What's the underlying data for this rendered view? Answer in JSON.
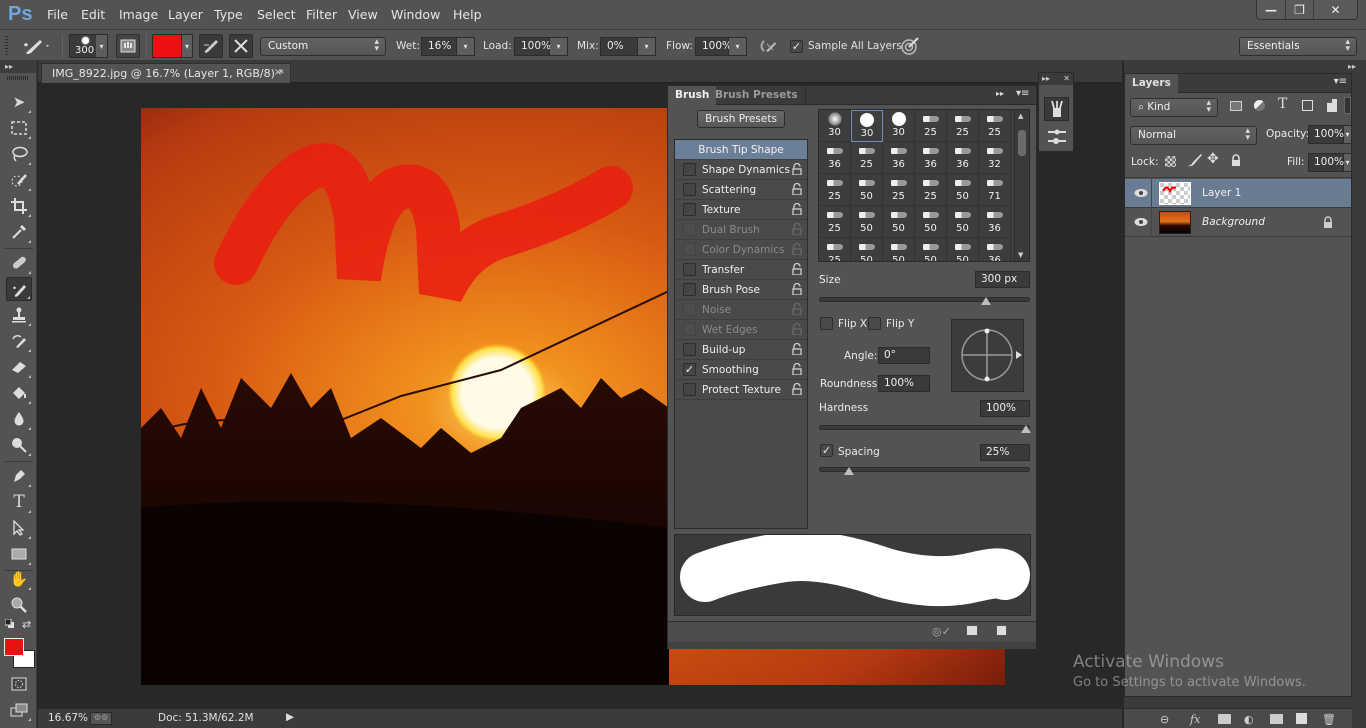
{
  "app": {
    "logo": "Ps"
  },
  "menu": [
    "File",
    "Edit",
    "Image",
    "Layer",
    "Type",
    "Select",
    "Filter",
    "View",
    "Window",
    "Help"
  ],
  "window_controls": {
    "minimize": "—",
    "restore": "❐",
    "close": "✕"
  },
  "options_bar": {
    "brush_size": "300",
    "foreground_color": "#ee1111",
    "preset_mix": "Custom",
    "wet_label": "Wet:",
    "wet_value": "16%",
    "load_label": "Load:",
    "load_value": "100%",
    "mix_label": "Mix:",
    "mix_value": "0%",
    "flow_label": "Flow:",
    "flow_value": "100%",
    "sample_all_layers_label": "Sample All Layers",
    "sample_all_layers_checked": true,
    "workspace": "Essentials"
  },
  "document": {
    "tab_title": "IMG_8922.jpg @ 16.7% (Layer 1, RGB/8) *",
    "close": "×"
  },
  "status_bar": {
    "zoom": "16.67%",
    "doc_info": "Doc: 51.3M/62.2M"
  },
  "brush_panel": {
    "tabs": [
      "Brush",
      "Brush Presets"
    ],
    "presets_button": "Brush Presets",
    "list": [
      {
        "label": "Brush Tip Shape",
        "selected": true
      },
      {
        "label": "Shape Dynamics",
        "checked": false,
        "enabled": true
      },
      {
        "label": "Scattering",
        "checked": false,
        "enabled": true
      },
      {
        "label": "Texture",
        "checked": false,
        "enabled": true
      },
      {
        "label": "Dual Brush",
        "checked": false,
        "enabled": false
      },
      {
        "label": "Color Dynamics",
        "checked": false,
        "enabled": false
      },
      {
        "label": "Transfer",
        "checked": false,
        "enabled": true
      },
      {
        "label": "Brush Pose",
        "checked": false,
        "enabled": true
      },
      {
        "label": "Noise",
        "checked": false,
        "enabled": false
      },
      {
        "label": "Wet Edges",
        "checked": false,
        "enabled": false
      },
      {
        "label": "Build-up",
        "checked": false,
        "enabled": true
      },
      {
        "label": "Smoothing",
        "checked": true,
        "enabled": true
      },
      {
        "label": "Protect Texture",
        "checked": false,
        "enabled": true
      }
    ],
    "tip_sizes": [
      "30",
      "30",
      "30",
      "25",
      "25",
      "25",
      "36",
      "25",
      "36",
      "36",
      "36",
      "32",
      "25",
      "50",
      "25",
      "25",
      "50",
      "71",
      "25",
      "50",
      "50",
      "50",
      "50",
      "36",
      "25",
      "50",
      "50",
      "50",
      "50",
      "36"
    ],
    "size_label": "Size",
    "size_value": "300 px",
    "flip_x": "Flip X",
    "flip_y": "Flip Y",
    "angle_label": "Angle:",
    "angle_value": "0°",
    "roundness_label": "Roundness:",
    "roundness_value": "100%",
    "hardness_label": "Hardness",
    "hardness_value": "100%",
    "spacing_label": "Spacing",
    "spacing_value": "25%",
    "spacing_checked": true,
    "size_slider_fraction": 0.8,
    "hardness_slider_fraction": 1.0,
    "spacing_slider_fraction": 0.12
  },
  "layers_panel": {
    "title": "Layers",
    "filter": "Kind",
    "blend_mode": "Normal",
    "opacity_label": "Opacity:",
    "opacity_value": "100%",
    "lock_label": "Lock:",
    "fill_label": "Fill:",
    "fill_value": "100%",
    "layers": [
      {
        "name": "Layer 1",
        "selected": true,
        "visible": true
      },
      {
        "name": "Background",
        "selected": false,
        "visible": true,
        "locked": true
      }
    ]
  },
  "watermark": {
    "title": "Activate Windows",
    "subtitle": "Go to Settings to activate Windows."
  },
  "colors": {
    "foreground": "#ee1111",
    "background": "#ffffff",
    "selection": "#6b7f98"
  }
}
